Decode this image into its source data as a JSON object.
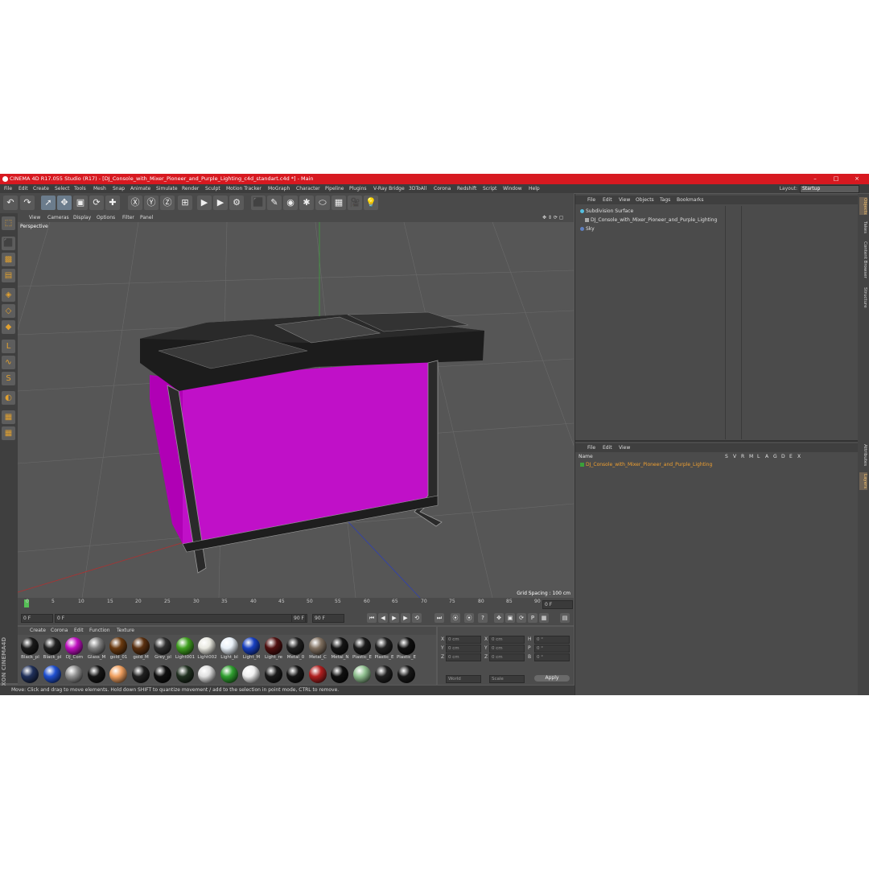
{
  "window": {
    "title": "CINEMA 4D R17.055 Studio (R17) - [DJ_Console_with_Mixer_Pioneer_and_Purple_Lighting_c4d_standart.c4d *] - Main"
  },
  "menu": [
    "File",
    "Edit",
    "Create",
    "Select",
    "Tools",
    "Mesh",
    "Snap",
    "Animate",
    "Simulate",
    "Render",
    "Sculpt",
    "Motion Tracker",
    "MoGraph",
    "Character",
    "Pipeline",
    "Plugins",
    "V-Ray Bridge",
    "3DToAll",
    "Corona",
    "Redshift",
    "Script",
    "Window",
    "Help"
  ],
  "layout": {
    "label": "Layout:",
    "value": "Startup"
  },
  "viewport": {
    "menu": [
      "View",
      "Cameras",
      "Display",
      "Options",
      "Filter",
      "Panel"
    ],
    "camera": "Perspective",
    "grid_spacing": "Grid Spacing : 100 cm"
  },
  "timeline": {
    "ticks": [
      "0",
      "5",
      "10",
      "15",
      "20",
      "25",
      "30",
      "35",
      "40",
      "45",
      "50",
      "55",
      "60",
      "65",
      "70",
      "75",
      "80",
      "85",
      "90"
    ],
    "frame_end_display": "0 F"
  },
  "transport": {
    "start": "0 F",
    "current": "0 F",
    "end": "90 F",
    "end2": "90 F"
  },
  "materials": {
    "menu": [
      "Create",
      "Corona",
      "Edit",
      "Function",
      "Texture"
    ],
    "row1": [
      {
        "label": "Black_pl",
        "color": "#1a1a1a"
      },
      {
        "label": "Black_pl",
        "color": "#222222"
      },
      {
        "label": "DJ_Com",
        "color": "#c010c0"
      },
      {
        "label": "Glass_M",
        "color": "#808080"
      },
      {
        "label": "gold_01",
        "color": "#6a3a10"
      },
      {
        "label": "gold_M",
        "color": "#5a3010"
      },
      {
        "label": "Grey_pl",
        "color": "#303030"
      },
      {
        "label": "Light001",
        "color": "#40a020"
      },
      {
        "label": "Light002",
        "color": "#e8e8e0"
      },
      {
        "label": "Light_bl",
        "color": "#e8f0f8"
      },
      {
        "label": "Light_M",
        "color": "#1840c0"
      },
      {
        "label": "Light_re",
        "color": "#501010"
      },
      {
        "label": "Metal_0",
        "color": "#202020"
      },
      {
        "label": "Metal_C",
        "color": "#807060"
      },
      {
        "label": "Metal_N",
        "color": "#151515"
      },
      {
        "label": "Plastic_E",
        "color": "#1a1a1a"
      },
      {
        "label": "Plastic_E",
        "color": "#202020"
      },
      {
        "label": "Plastic_E",
        "color": "#101010"
      }
    ],
    "row2": [
      "#20305a",
      "#2050d0",
      "#909090",
      "#151515",
      "#f0a060",
      "#202020",
      "#101010",
      "#203020",
      "#e0e0e0",
      "#30a030",
      "#f0f0f0",
      "#1a1a1a",
      "#151515",
      "#b02020",
      "#101010",
      "#90c090",
      "#202020",
      "#181818"
    ]
  },
  "coords": {
    "labels_left": [
      "X",
      "Y",
      "Z"
    ],
    "labels_mid": [
      "X",
      "Y",
      "Z"
    ],
    "labels_right": [
      "H",
      "P",
      "B"
    ],
    "pos_values": [
      "0 cm",
      "0 cm",
      "0 cm"
    ],
    "size_values": [
      "0 cm",
      "0 cm",
      "0 cm"
    ],
    "rot_values": [
      "0 °",
      "0 °",
      "0 °"
    ],
    "mode1": "World",
    "mode2": "Scale",
    "apply": "Apply"
  },
  "status": "Move: Click and drag to move elements. Hold down SHIFT to quantize movement / add to the selection in point mode, CTRL to remove.",
  "objects": {
    "menu": [
      "File",
      "Edit",
      "View",
      "Objects",
      "Tags",
      "Bookmarks"
    ],
    "items": [
      "Subdivision Surface",
      "DJ_Console_with_Mixer_Pioneer_and_Purple_Lighting",
      "Sky"
    ]
  },
  "layers": {
    "menu": [
      "File",
      "Edit",
      "View"
    ],
    "header": "Name",
    "cols": [
      "S",
      "V",
      "R",
      "M",
      "L",
      "A",
      "G",
      "D",
      "E",
      "X"
    ],
    "item": "DJ_Console_with_Mixer_Pioneer_and_Purple_Lighting"
  },
  "side_tabs": [
    "Objects",
    "Takes",
    "Content Browser",
    "Structure",
    "Attributes",
    "Layers"
  ],
  "colors": {
    "accent": "#d71920",
    "magenta": "#c010c8",
    "layer_text": "#f0a030"
  }
}
